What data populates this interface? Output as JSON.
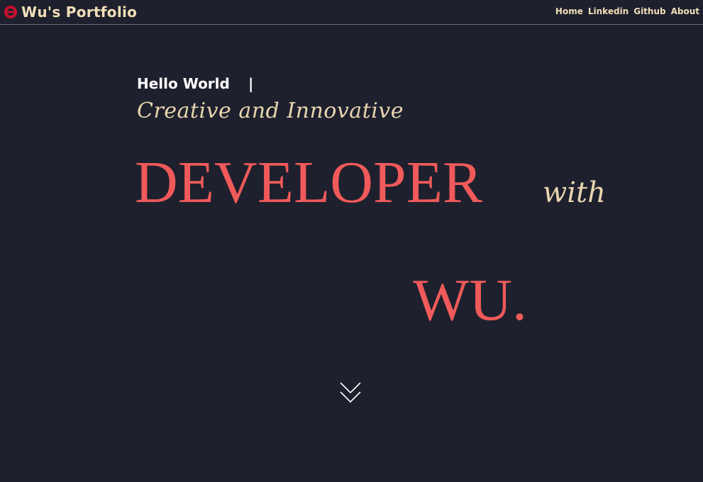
{
  "header": {
    "logo_icon": "portfolio-logo-icon",
    "title": "Wu's Portfolio",
    "brand_color": "#f2dfb8",
    "logo_color": "#c8102e"
  },
  "nav": {
    "items": [
      {
        "label": "Home"
      },
      {
        "label": "Linkedin"
      },
      {
        "label": "Github"
      },
      {
        "label": "About"
      }
    ]
  },
  "hero": {
    "greeting": "Hello World",
    "cursor": "|",
    "tagline": "Creative and Innovative",
    "headline": "DEVELOPER",
    "connector": "with",
    "name": "WU.",
    "scroll_icon": "double-chevron-down-icon",
    "accent_color": "#f05a5a",
    "script_color": "#e9d6b0"
  },
  "theme": {
    "background": "#1e202d"
  }
}
